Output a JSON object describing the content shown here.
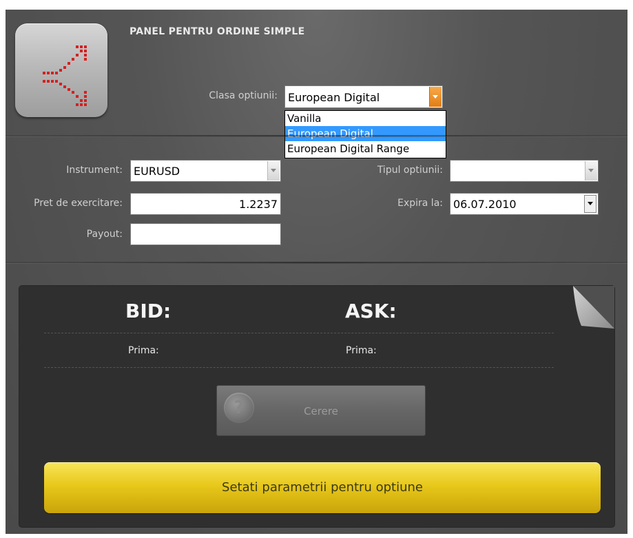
{
  "panel": {
    "title": "PANEL PENTRU ORDINE SIMPLE"
  },
  "class_option": {
    "label": "Clasa optiunii:",
    "value": "European Digital",
    "options": [
      "Vanilla",
      "European Digital",
      "European Digital Range"
    ],
    "selected_index": 1
  },
  "instrument": {
    "label": "Instrument:",
    "value": "EURUSD"
  },
  "option_type": {
    "label": "Tipul optiunii:",
    "value": ""
  },
  "strike": {
    "label": "Pret de exercitare:",
    "value": "1.2237"
  },
  "expiry": {
    "label": "Expira la:",
    "value": "06.07.2010"
  },
  "payout": {
    "label": "Payout:",
    "value": ""
  },
  "quote": {
    "bid_label": "BID:",
    "ask_label": "ASK:",
    "bid_prima_label": "Prima:",
    "ask_prima_label": "Prima:"
  },
  "request_button": {
    "label": "Cerere",
    "icon": "question-icon"
  },
  "set_button": {
    "label": "Setati parametrii pentru optiune"
  },
  "colors": {
    "accent": "#e8c81a",
    "dropdown_accent": "#e27e14",
    "selection": "#3399ff",
    "logo_arrows": "#d42020"
  }
}
